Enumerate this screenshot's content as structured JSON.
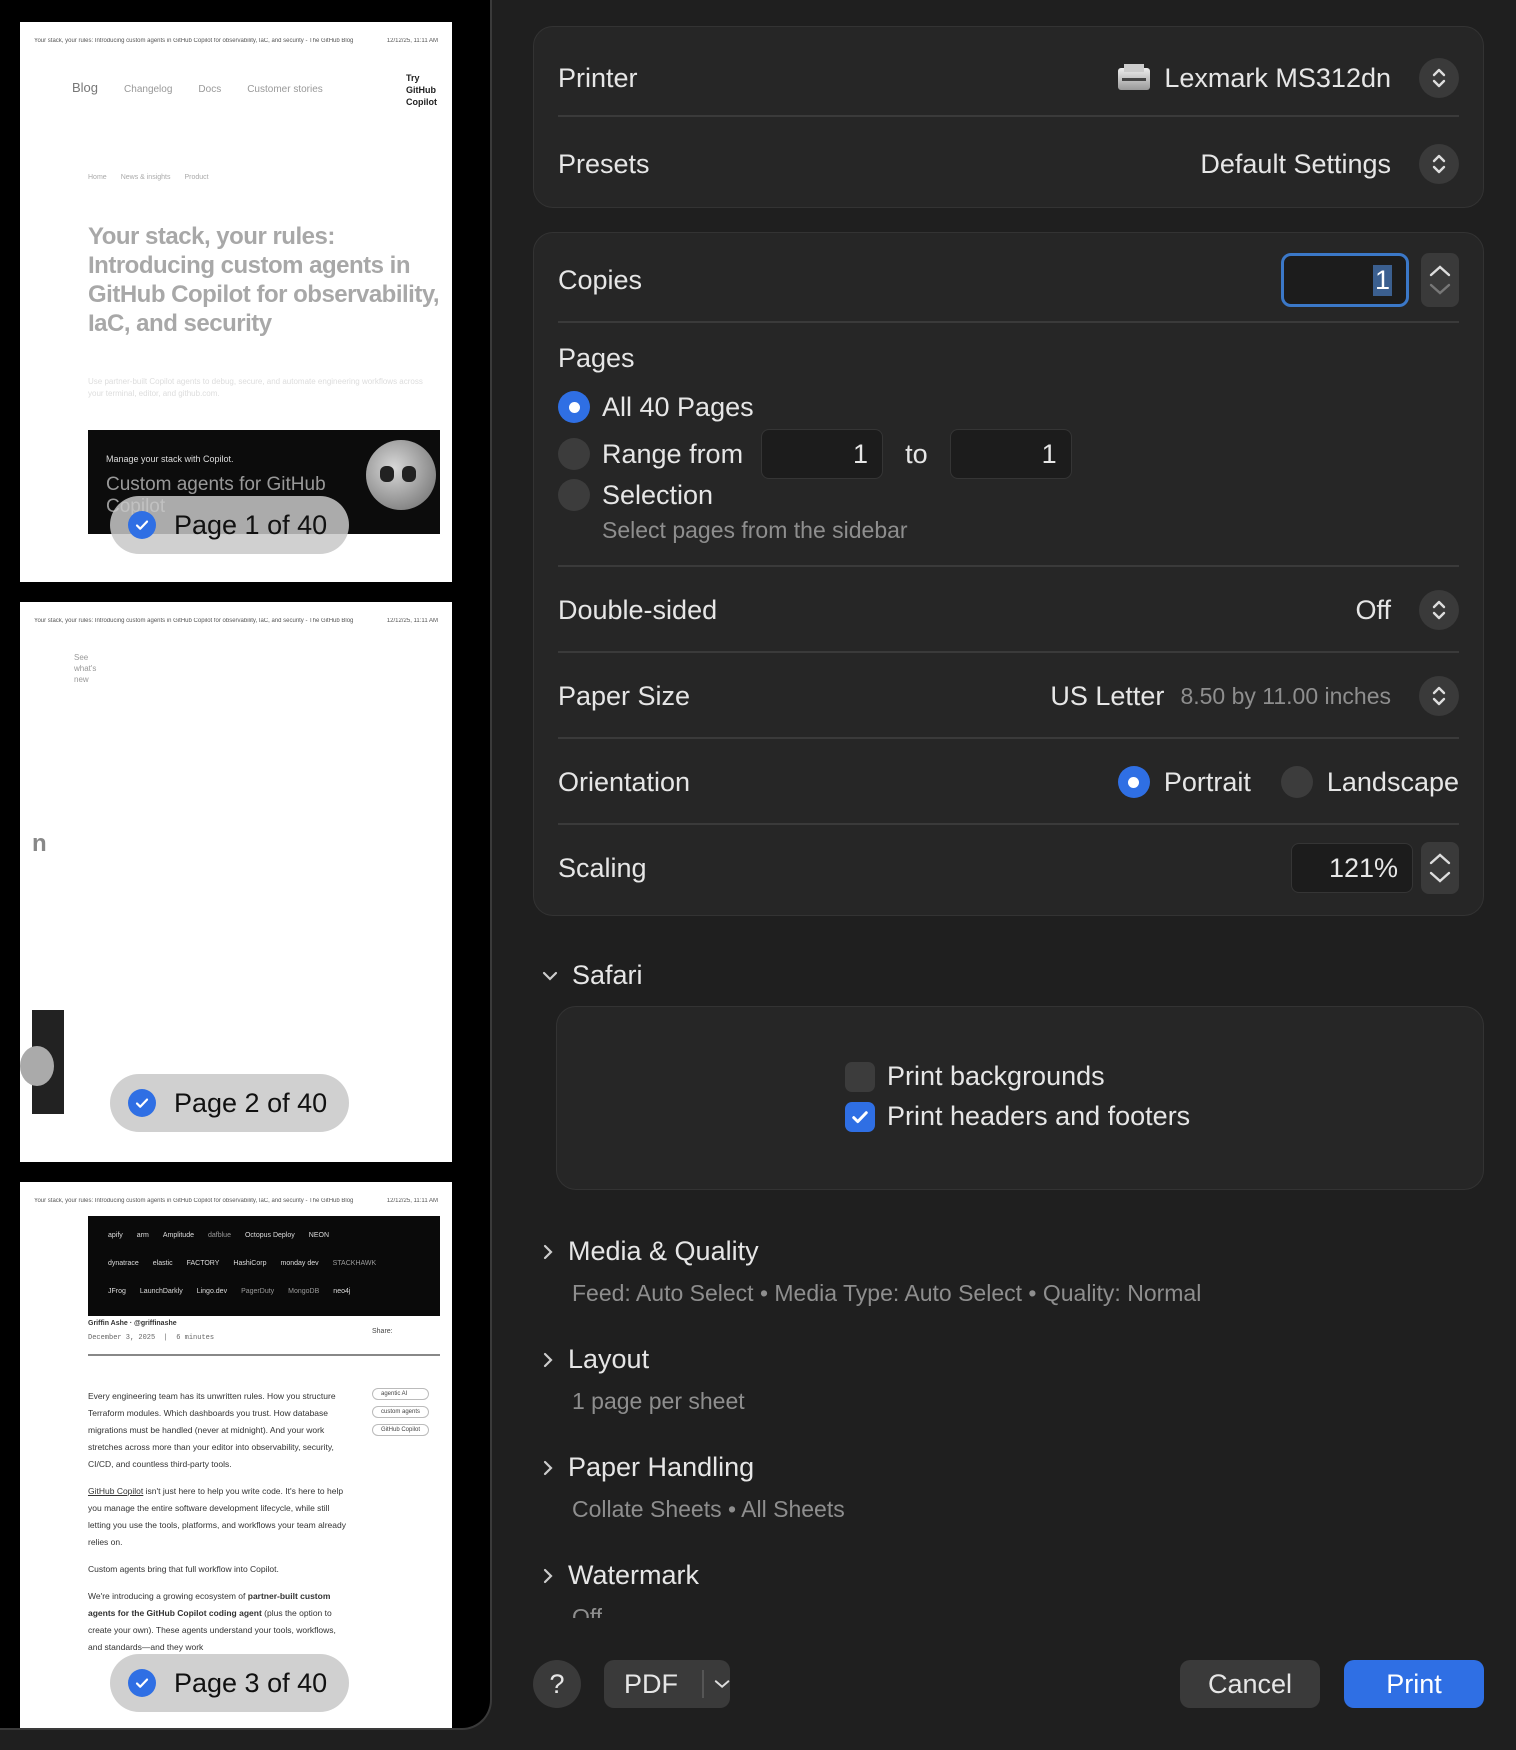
{
  "thumbnails": [
    {
      "badge": "Page 1 of 40",
      "header_text": "Your stack, your rules: Introducing custom agents in GitHub Copilot for observability, IaC, and security - The GitHub Blog",
      "header_date": "12/12/25, 11:11 AM",
      "nav": [
        "Blog",
        "Changelog",
        "Docs",
        "Customer stories"
      ],
      "try_label": "Try GitHub Copilot",
      "breadcrumb": [
        "Home",
        "News & insights",
        "Product"
      ],
      "headline": "Your stack, your rules: Introducing custom agents in GitHub Copilot for observability, IaC, and security",
      "dek": "Use partner-built Copilot agents to debug, secure, and automate engineering workflows across your terminal, editor, and github.com.",
      "hero_small": "Manage your stack with Copilot.",
      "hero_big": "Custom agents for GitHub Copilot"
    },
    {
      "badge": "Page 2 of 40",
      "see_new": "See what's new",
      "fragment": "n"
    },
    {
      "badge": "Page 3 of 40",
      "logos_row1": [
        "apify",
        "arm",
        "Amplitude",
        "dafblue",
        "Octopus Deploy",
        "NEON"
      ],
      "logos_row2": [
        "dynatrace",
        "elastic",
        "FACTORY",
        "HashiCorp",
        "monday dev",
        "STACKHAWK"
      ],
      "logos_row3": [
        "JFrog",
        "LaunchDarkly",
        "Lingo.dev",
        "PagerDuty",
        "MongoDB",
        "neo4j"
      ],
      "author": "Griffin Ashe · @griffinashe",
      "date": "December 3, 2025",
      "readtime": "6 minutes",
      "share": "Share:",
      "tags": [
        "agentic AI",
        "custom agents",
        "GitHub Copilot"
      ],
      "para1": "Every engineering team has its unwritten rules. How you structure Terraform modules. Which dashboards you trust. How database migrations must be handled (never at midnight). And your work stretches across more than your editor into observability, security, CI/CD, and countless third-party tools.",
      "para2_link": "GitHub Copilot",
      "para2": "isn't just here to help you write code. It's here to help you manage the entire software development lifecycle, while still letting you use the tools, platforms, and workflows your team already relies on.",
      "para3": "Custom agents bring that full workflow into Copilot.",
      "para4a": "We're introducing a growing ecosystem of",
      "para4b": "partner-built custom agents for the GitHub Copilot coding agent",
      "para4c": "(plus the option to create your own). These agents understand your tools, workflows, and standards—and they work"
    }
  ],
  "printer": {
    "label": "Printer",
    "value": "Lexmark MS312dn"
  },
  "presets": {
    "label": "Presets",
    "value": "Default Settings"
  },
  "copies": {
    "label": "Copies",
    "value": "1"
  },
  "pages": {
    "label": "Pages",
    "all": "All 40 Pages",
    "range_label": "Range from",
    "range_from": "1",
    "range_to_label": "to",
    "range_to": "1",
    "selection": "Selection",
    "selection_hint": "Select pages from the sidebar",
    "selected": "all"
  },
  "double_sided": {
    "label": "Double-sided",
    "value": "Off"
  },
  "paper_size": {
    "label": "Paper Size",
    "value": "US Letter",
    "detail": "8.50 by 11.00 inches"
  },
  "orientation": {
    "label": "Orientation",
    "portrait": "Portrait",
    "landscape": "Landscape",
    "selected": "portrait"
  },
  "scaling": {
    "label": "Scaling",
    "value": "121%"
  },
  "safari": {
    "title": "Safari",
    "print_backgrounds": "Print backgrounds",
    "print_backgrounds_checked": false,
    "print_headers": "Print headers and footers",
    "print_headers_checked": true
  },
  "sections": [
    {
      "title": "Media & Quality",
      "summary": "Feed: Auto Select • Media Type: Auto Select • Quality: Normal"
    },
    {
      "title": "Layout",
      "summary": "1 page per sheet"
    },
    {
      "title": "Paper Handling",
      "summary": "Collate Sheets • All Sheets"
    },
    {
      "title": "Watermark",
      "summary": "Off"
    }
  ],
  "footer": {
    "help": "?",
    "pdf": "PDF",
    "cancel": "Cancel",
    "print": "Print"
  },
  "colors": {
    "accent": "#2f6fe4",
    "panel": "#262626",
    "background": "#1f1f1f"
  }
}
